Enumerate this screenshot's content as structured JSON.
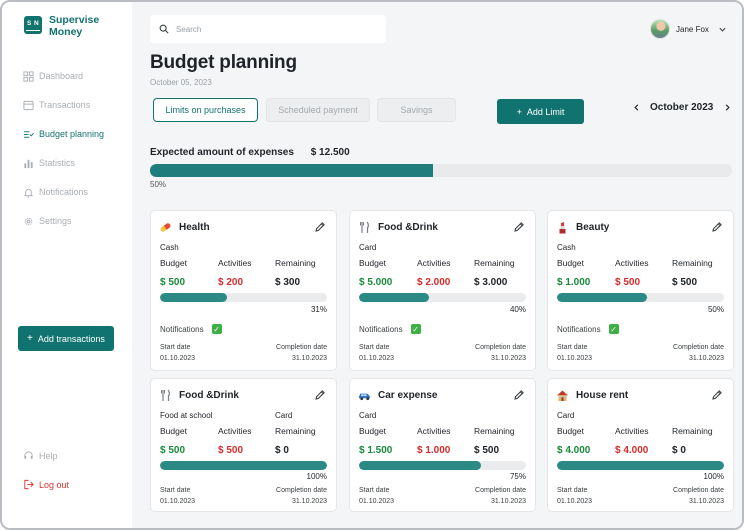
{
  "app": {
    "brand_line1": "Supervise",
    "brand_line2": "Money",
    "logo_s": "S",
    "logo_n": "N"
  },
  "sidebar": {
    "items": [
      {
        "label": "Dashboard",
        "icon": "dashboard-icon"
      },
      {
        "label": "Transactions",
        "icon": "transactions-icon"
      },
      {
        "label": "Budget planning",
        "icon": "budget-icon",
        "active": true
      },
      {
        "label": "Statistics",
        "icon": "statistics-icon"
      },
      {
        "label": "Notifications",
        "icon": "bell-icon"
      },
      {
        "label": "Settings",
        "icon": "gear-icon"
      }
    ],
    "add_transactions": "Add transactions",
    "help": "Help",
    "logout": "Log out"
  },
  "header": {
    "search_placeholder": "Search",
    "user_name": "Jane Fox"
  },
  "page": {
    "title": "Budget planning",
    "date": "October 05, 2023",
    "tabs": [
      "Limits on purchases",
      "Scheduled payment",
      "Savings"
    ],
    "add_limit": "Add Limit",
    "month": "October 2023",
    "expected_label": "Expected amount of expenses",
    "expected_amount": "$ 12.500",
    "expected_pct": "50%",
    "expected_fraction": 0.487
  },
  "labels": {
    "budget": "Budget",
    "activities": "Activities",
    "remaining": "Remaining",
    "notifications": "Notifications",
    "start_date": "Start date",
    "completion_date": "Completion date"
  },
  "colors": {
    "accent": "#11736f",
    "positive": "#1a8a3a",
    "negative": "#d62b2b"
  },
  "cards": [
    {
      "name": "Health",
      "icon": "pill-icon",
      "payment": "Cash",
      "payment2": "",
      "budget": "$ 500",
      "activities": "$ 200",
      "remaining": "$ 300",
      "remaining_color": "dark",
      "pct": "31%",
      "fraction": 0.4,
      "notifications": true,
      "start": "01.10.2023",
      "end": "31.10.2023"
    },
    {
      "name": "Food &Drink",
      "icon": "fork-knife-icon",
      "payment": "Card",
      "payment2": "",
      "budget": "$ 5.000",
      "activities": "$ 2.000",
      "remaining": "$ 3.000",
      "remaining_color": "dark",
      "pct": "40%",
      "fraction": 0.42,
      "notifications": true,
      "start": "01.10.2023",
      "end": "31.10.2023"
    },
    {
      "name": "Beauty",
      "icon": "lipstick-icon",
      "payment": "Cash",
      "payment2": "",
      "budget": "$ 1.000",
      "activities": "$ 500",
      "remaining": "$ 500",
      "remaining_color": "dark",
      "pct": "50%",
      "fraction": 0.54,
      "notifications": true,
      "start": "01.10.2023",
      "end": "31.10.2023"
    },
    {
      "name": "Food &Drink",
      "icon": "fork-knife-icon",
      "payment": "Food at school",
      "payment2": "Card",
      "budget": "$ 500",
      "activities": "$ 500",
      "remaining": "$ 0",
      "remaining_color": "dark",
      "pct": "100%",
      "fraction": 1.0,
      "notifications": false,
      "start": "01.10.2023",
      "end": "31.10.2023"
    },
    {
      "name": "Car expense",
      "icon": "car-icon",
      "payment": "Card",
      "payment2": "",
      "budget": "$ 1.500",
      "activities": "$ 1.000",
      "remaining": "$ 500",
      "remaining_color": "dark",
      "pct": "75%",
      "fraction": 0.73,
      "notifications": false,
      "start": "01.10.2023",
      "end": "31.10.2023"
    },
    {
      "name": "House rent",
      "icon": "house-icon",
      "payment": "Card",
      "payment2": "",
      "budget": "$ 4.000",
      "activities": "$ 4.000",
      "remaining": "$ 0",
      "remaining_color": "dark",
      "pct": "100%",
      "fraction": 1.0,
      "notifications": false,
      "start": "01.10.2023",
      "end": "31.10.2023"
    }
  ]
}
